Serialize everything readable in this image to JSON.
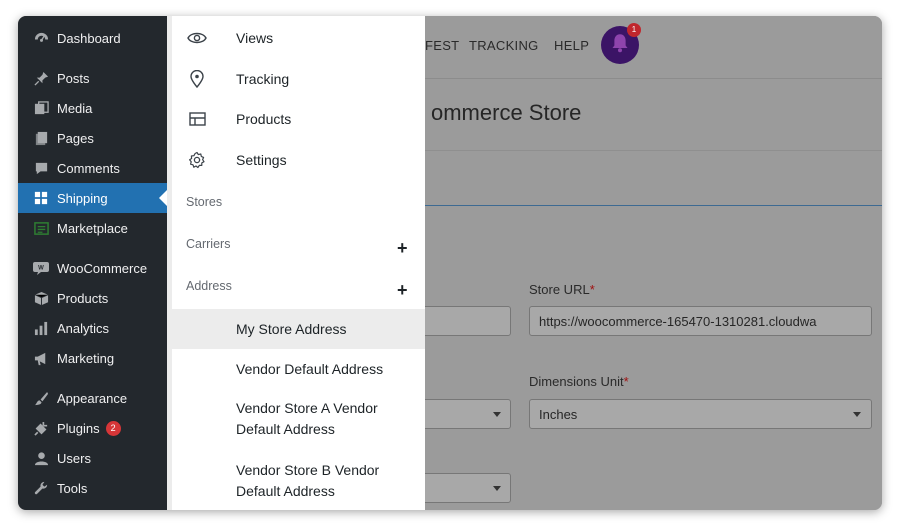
{
  "sidebar": {
    "items": [
      {
        "label": "Dashboard",
        "icon": "dashboard-icon"
      },
      {
        "label": "Posts",
        "icon": "pin-icon"
      },
      {
        "label": "Media",
        "icon": "media-icon"
      },
      {
        "label": "Pages",
        "icon": "pages-icon"
      },
      {
        "label": "Comments",
        "icon": "comment-icon"
      },
      {
        "label": "Shipping",
        "icon": "grid-icon",
        "active": true
      },
      {
        "label": "Marketplace",
        "icon": "marketplace-icon"
      },
      {
        "label": "WooCommerce",
        "icon": "woo-icon"
      },
      {
        "label": "Products",
        "icon": "box-icon"
      },
      {
        "label": "Analytics",
        "icon": "bar-chart-icon"
      },
      {
        "label": "Marketing",
        "icon": "megaphone-icon"
      },
      {
        "label": "Appearance",
        "icon": "brush-icon"
      },
      {
        "label": "Plugins",
        "icon": "plug-icon",
        "badge": "2"
      },
      {
        "label": "Users",
        "icon": "user-icon"
      },
      {
        "label": "Tools",
        "icon": "wrench-icon"
      }
    ],
    "accent": "#2271b1"
  },
  "flyout": {
    "items": [
      {
        "label": "Views",
        "icon": "eye-icon"
      },
      {
        "label": "Tracking",
        "icon": "location-pin-icon"
      },
      {
        "label": "Products",
        "icon": "table-icon"
      },
      {
        "label": "Settings",
        "icon": "gear-icon"
      }
    ],
    "sections": {
      "stores": "Stores",
      "carriers": "Carriers",
      "address": "Address"
    },
    "plus": "+",
    "sub_items": [
      {
        "label": "My Store Address",
        "active": true
      },
      {
        "label": "Vendor Default Address"
      },
      {
        "label_line1": "Vendor Store A Vendor",
        "label_line2": "Default Address"
      },
      {
        "label_line1": "Vendor Store B Vendor",
        "label_line2": "Default Address"
      }
    ]
  },
  "topnav": {
    "links": [
      "FEST",
      "TRACKING",
      "HELP"
    ],
    "bell_badge": "1"
  },
  "main": {
    "title": "ommerce Store",
    "store_url_label": "Store URL",
    "store_url_value": "https://woocommerce-165470-1310281.cloudwa",
    "dimensions_label": "Dimensions Unit",
    "dimensions_value": "Inches",
    "required_mark": "*"
  }
}
